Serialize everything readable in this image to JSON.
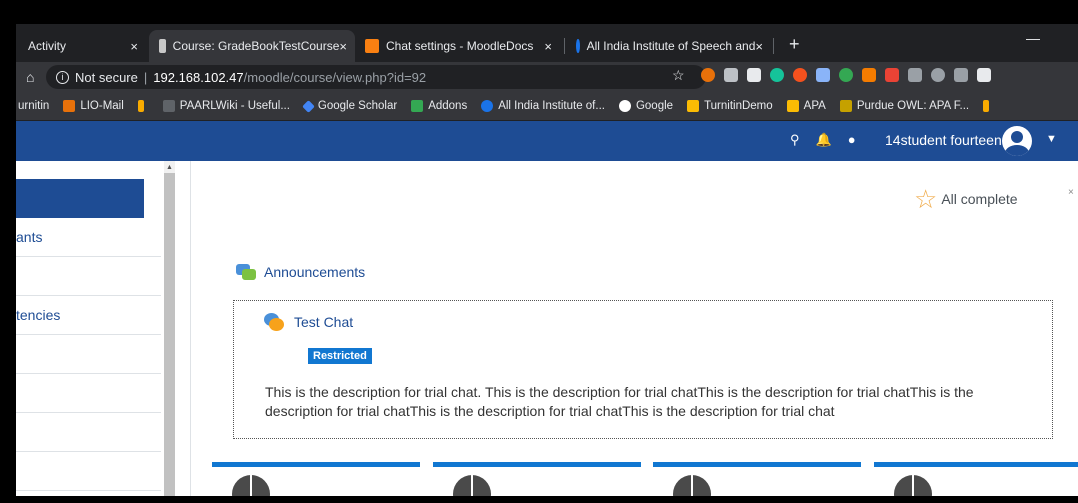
{
  "tabs": [
    {
      "label": "Activity",
      "active": false
    },
    {
      "label": "Course: GradeBookTestCourse",
      "active": true
    },
    {
      "label": "Chat settings - MoodleDocs",
      "active": false
    },
    {
      "label": "All India Institute of Speech and",
      "active": false
    }
  ],
  "tab_close_glyph": "×",
  "address": {
    "security": "Not secure",
    "host": "192.168.102.47",
    "path": "/moodle/course/view.php?id=92"
  },
  "bookmarks": [
    {
      "label": "urnitin",
      "color": "#e8eaed"
    },
    {
      "label": "LIO-Mail",
      "color": "#e8710a"
    },
    {
      "label": "",
      "color": "#f9ab00"
    },
    {
      "label": "PAARLWiki - Useful...",
      "color": "#5f6368"
    },
    {
      "label": "Google Scholar",
      "color": "#4285f4"
    },
    {
      "label": "Addons",
      "color": "#34a853"
    },
    {
      "label": "All India Institute of...",
      "color": "#1a73e8"
    },
    {
      "label": "Google",
      "color": "#ffffff"
    },
    {
      "label": "TurnitinDemo",
      "color": "#fbbc04"
    },
    {
      "label": "APA",
      "color": "#fbbc04"
    },
    {
      "label": "Purdue OWL: APA F...",
      "color": "#c5a100"
    },
    {
      "label": "",
      "color": "#f9ab00"
    }
  ],
  "navbar": {
    "username": "14student fourteen",
    "bg_color": "#1e4c94"
  },
  "drawer": {
    "items": [
      "",
      "ants",
      "",
      "tencies",
      "",
      "",
      ""
    ]
  },
  "main": {
    "completion": "All complete",
    "announcements": "Announcements",
    "activity_title": "Test Chat",
    "badge": "Restricted",
    "description": "This is the description for trial chat. This is the description for trial chatThis is the description for trial chatThis is the description for trial chatThis is the description for trial chatThis is the description for trial chat"
  }
}
